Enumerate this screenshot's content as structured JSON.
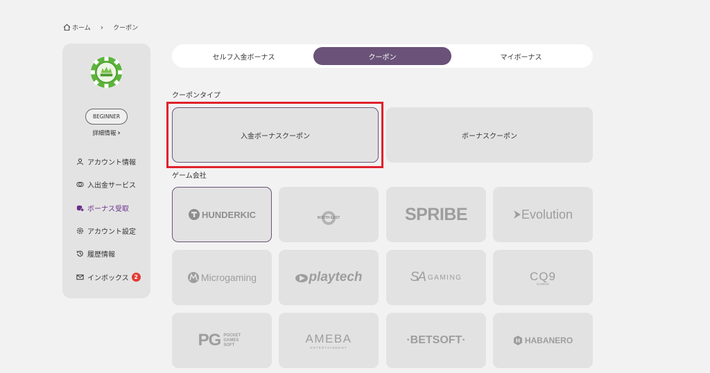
{
  "breadcrumb": {
    "home": "ホーム",
    "current": "クーポン"
  },
  "sidebar": {
    "rank": "BEGINNER",
    "detail_link": "詳細情報",
    "items": [
      {
        "label": "アカウント情報",
        "icon": "user-icon"
      },
      {
        "label": "入出金サービス",
        "icon": "transfer-icon"
      },
      {
        "label": "ボーナス受取",
        "icon": "bonus-icon",
        "active": true
      },
      {
        "label": "アカウント設定",
        "icon": "gear-icon"
      },
      {
        "label": "履歴情報",
        "icon": "history-icon"
      },
      {
        "label": "インボックス",
        "icon": "mail-icon",
        "badge": "2"
      }
    ]
  },
  "tabs": [
    {
      "label": "セルフ入金ボーナス"
    },
    {
      "label": "クーポン",
      "active": true
    },
    {
      "label": "マイボーナス"
    }
  ],
  "coupon_type": {
    "label": "クーポンタイプ",
    "options": [
      {
        "label": "入金ボーナスクーポン",
        "selected": true
      },
      {
        "label": "ボーナスクーポン"
      }
    ]
  },
  "game_company": {
    "label": "ゲーム会社",
    "providers": [
      "HUNDERKIC",
      "NORTH EAST",
      "SPRIBE",
      "Evolution",
      "Microgaming",
      "playtech",
      "GAMING",
      "CQ9",
      "PG",
      "AMEBA",
      "BETSOFT",
      "HABANERO"
    ],
    "provider_sublabels": {
      "cq9": "GAMING",
      "pg": "POCKET GAMES SOFT",
      "ameba": "ENTERTAINMENT"
    }
  },
  "colors": {
    "accent": "#6a5278",
    "highlight": "#e0202c",
    "badge": "#e53935"
  }
}
